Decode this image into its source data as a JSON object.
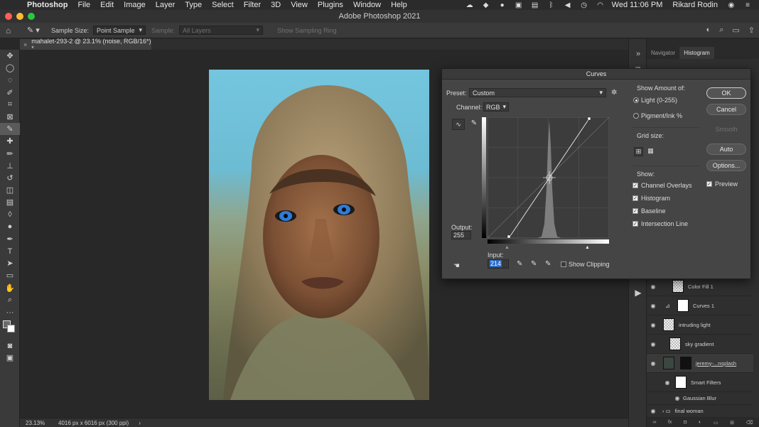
{
  "menubar": {
    "app": "Photoshop",
    "items": [
      "File",
      "Edit",
      "Image",
      "Layer",
      "Type",
      "Select",
      "Filter",
      "3D",
      "View",
      "Plugins",
      "Window",
      "Help"
    ],
    "clock": "Wed 11:06 PM",
    "user": "Rikard Rodin"
  },
  "window": {
    "title": "Adobe Photoshop 2021"
  },
  "options": {
    "sample_size_label": "Sample Size:",
    "sample_size_value": "Point Sample",
    "sample_label": "Sample:",
    "sample_value": "All Layers",
    "sampling_ring": "Show Sampling Ring"
  },
  "document": {
    "tab_title": "mahalet-293-2 @ 23.1% (noise, RGB/16*) *",
    "zoom": "23.13%",
    "size_info": "4016 px x 6016 px (300 ppi)",
    "status_arrow": "›"
  },
  "panels": {
    "tabs": [
      "Navigator",
      "Histogram"
    ],
    "active_tab": "Histogram"
  },
  "layers": [
    {
      "name": "Color Fill 1",
      "thumb": "checker"
    },
    {
      "name": "Curves 1",
      "thumb": "white"
    },
    {
      "name": "intruding light",
      "thumb": "checker"
    },
    {
      "name": "sky gradient",
      "thumb": "checker"
    },
    {
      "name": "jeremy-...nsplash",
      "thumb": "dark"
    },
    {
      "name": "Smart Filters",
      "thumb": "white"
    },
    {
      "name": "Gaussian Blur",
      "thumb": "none"
    },
    {
      "name": "final woman",
      "thumb": "none"
    }
  ],
  "curves": {
    "title": "Curves",
    "preset_label": "Preset:",
    "preset_value": "Custom",
    "channel_label": "Channel:",
    "channel_value": "RGB",
    "output_label": "Output:",
    "output_value": "255",
    "input_label": "Input:",
    "input_value": "214",
    "show_clipping": "Show Clipping",
    "show_amount_label": "Show Amount of:",
    "light_option": "Light  (0-255)",
    "pigment_option": "Pigment/Ink %",
    "grid_size_label": "Grid size:",
    "show_label": "Show:",
    "show_options": [
      "Channel Overlays",
      "Histogram",
      "Baseline",
      "Intersection Line"
    ],
    "buttons": {
      "ok": "OK",
      "cancel": "Cancel",
      "smooth": "Smooth",
      "auto": "Auto",
      "options": "Options..."
    },
    "preview_label": "Preview",
    "curve_points": [
      [
        0,
        0
      ],
      [
        214,
        255
      ]
    ]
  }
}
